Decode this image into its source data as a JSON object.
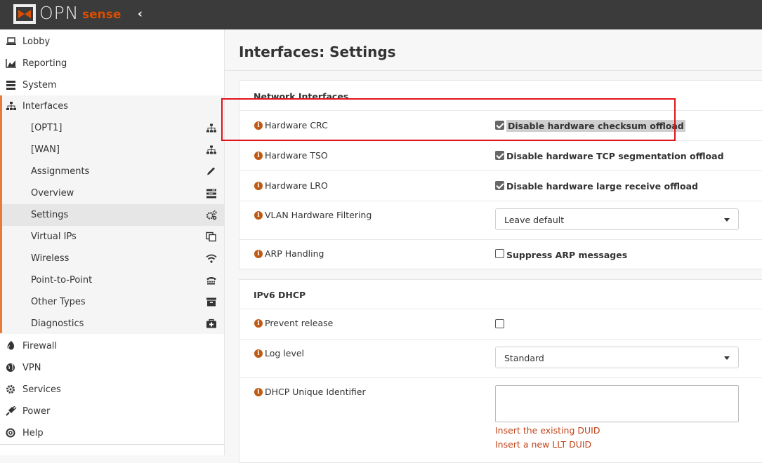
{
  "brand": {
    "logo_text": "OPN",
    "logo_suffix": "sense",
    "collapse_glyph": "‹"
  },
  "sidebar": {
    "items": [
      {
        "label": "Lobby",
        "icon": "laptop-icon"
      },
      {
        "label": "Reporting",
        "icon": "area-chart-icon"
      },
      {
        "label": "System",
        "icon": "server-icon"
      },
      {
        "label": "Interfaces",
        "icon": "sitemap-icon"
      }
    ],
    "interfaces_sub": [
      {
        "label": "[OPT1]",
        "icon": "sitemap-icon"
      },
      {
        "label": "[WAN]",
        "icon": "sitemap-icon"
      },
      {
        "label": "Assignments",
        "icon": "pencil-icon"
      },
      {
        "label": "Overview",
        "icon": "tasks-icon"
      },
      {
        "label": "Settings",
        "icon": "cogs-icon"
      },
      {
        "label": "Virtual IPs",
        "icon": "clone-icon"
      },
      {
        "label": "Wireless",
        "icon": "wifi-icon"
      },
      {
        "label": "Point-to-Point",
        "icon": "tty-icon"
      },
      {
        "label": "Other Types",
        "icon": "archive-icon"
      },
      {
        "label": "Diagnostics",
        "icon": "medkit-icon"
      }
    ],
    "items_after": [
      {
        "label": "Firewall",
        "icon": "fire-icon"
      },
      {
        "label": "VPN",
        "icon": "globe-icon"
      },
      {
        "label": "Services",
        "icon": "cog-icon"
      },
      {
        "label": "Power",
        "icon": "plug-icon"
      },
      {
        "label": "Help",
        "icon": "life-ring-icon"
      }
    ]
  },
  "main": {
    "title": "Interfaces: Settings",
    "network": {
      "heading": "Network Interfaces",
      "hw_crc": {
        "label": "Hardware CRC",
        "option": "Disable hardware checksum offload",
        "checked": true
      },
      "hw_tso": {
        "label": "Hardware TSO",
        "option": "Disable hardware TCP segmentation offload",
        "checked": true
      },
      "hw_lro": {
        "label": "Hardware LRO",
        "option": "Disable hardware large receive offload",
        "checked": true
      },
      "vlan": {
        "label": "VLAN Hardware Filtering",
        "value": "Leave default"
      },
      "arp": {
        "label": "ARP Handling",
        "option": "Suppress ARP messages",
        "checked": false
      }
    },
    "ipv6": {
      "heading": "IPv6 DHCP",
      "prevent": {
        "label": "Prevent release",
        "checked": false
      },
      "loglevel": {
        "label": "Log level",
        "value": "Standard"
      },
      "duid": {
        "label": "DHCP Unique Identifier",
        "value": "",
        "link1": "Insert the existing DUID",
        "link2": "Insert a new LLT DUID"
      }
    }
  },
  "colors": {
    "topbar": "#3b3b3b",
    "accent": "#e77b37",
    "highlight_box": "#e0141b",
    "link": "#c0431a"
  }
}
